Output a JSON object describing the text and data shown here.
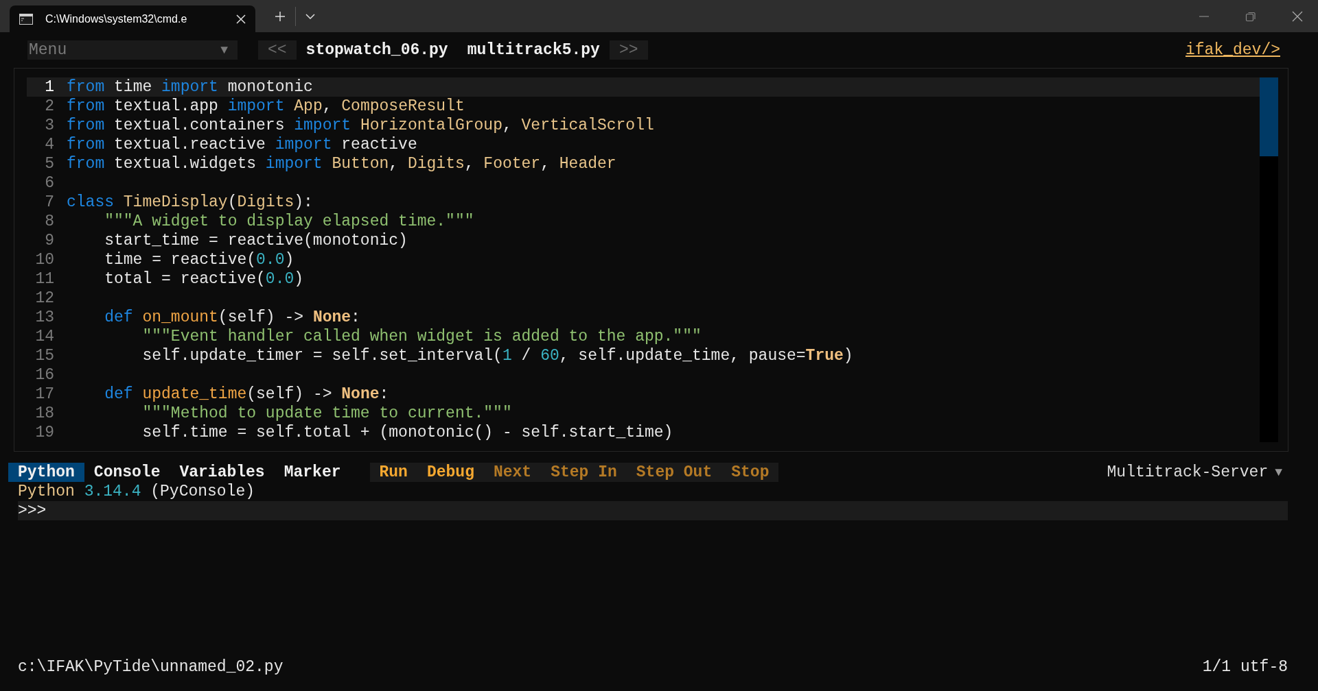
{
  "window": {
    "tab_title": "C:\\Windows\\system32\\cmd.e"
  },
  "toolbar": {
    "menu": {
      "label": "Menu",
      "arrow": "▼"
    },
    "nav_prev": "<<",
    "nav_next": ">>",
    "files": [
      {
        "label": "stopwatch_06.py",
        "selected": false
      },
      {
        "label": "multitrack5.py",
        "selected": false
      }
    ],
    "link": "ifak_dev/>"
  },
  "editor": {
    "lines": [
      {
        "number": "1",
        "current": true,
        "tokens": [
          {
            "kind": "kw",
            "text": "from"
          },
          {
            "kind": "plain",
            "text": " time "
          },
          {
            "kind": "kw",
            "text": "import"
          },
          {
            "kind": "plain",
            "text": " monotonic"
          }
        ]
      },
      {
        "number": "2",
        "current": false,
        "tokens": [
          {
            "kind": "kw",
            "text": "from"
          },
          {
            "kind": "plain",
            "text": " textual.app "
          },
          {
            "kind": "kw",
            "text": "import"
          },
          {
            "kind": "name",
            "text": " App"
          },
          {
            "kind": "plain",
            "text": ", "
          },
          {
            "kind": "name",
            "text": "ComposeResult"
          }
        ]
      },
      {
        "number": "3",
        "current": false,
        "tokens": [
          {
            "kind": "kw",
            "text": "from"
          },
          {
            "kind": "plain",
            "text": " textual.containers "
          },
          {
            "kind": "kw",
            "text": "import"
          },
          {
            "kind": "name",
            "text": " HorizontalGroup"
          },
          {
            "kind": "plain",
            "text": ", "
          },
          {
            "kind": "name",
            "text": "VerticalScroll"
          }
        ]
      },
      {
        "number": "4",
        "current": false,
        "tokens": [
          {
            "kind": "kw",
            "text": "from"
          },
          {
            "kind": "plain",
            "text": " textual.reactive "
          },
          {
            "kind": "kw",
            "text": "import"
          },
          {
            "kind": "plain",
            "text": " reactive"
          }
        ]
      },
      {
        "number": "5",
        "current": false,
        "tokens": [
          {
            "kind": "kw",
            "text": "from"
          },
          {
            "kind": "plain",
            "text": " textual.widgets "
          },
          {
            "kind": "kw",
            "text": "import"
          },
          {
            "kind": "name",
            "text": " Button"
          },
          {
            "kind": "plain",
            "text": ", "
          },
          {
            "kind": "name",
            "text": "Digits"
          },
          {
            "kind": "plain",
            "text": ", "
          },
          {
            "kind": "name",
            "text": "Footer"
          },
          {
            "kind": "plain",
            "text": ", "
          },
          {
            "kind": "name",
            "text": "Header"
          }
        ]
      },
      {
        "number": "6",
        "current": false
      },
      {
        "number": "7",
        "current": false,
        "tokens": [
          {
            "kind": "kw",
            "text": "class"
          },
          {
            "kind": "name",
            "text": " TimeDisplay"
          },
          {
            "kind": "plain",
            "text": "("
          },
          {
            "kind": "name",
            "text": "Digits"
          },
          {
            "kind": "plain",
            "text": "):"
          }
        ]
      },
      {
        "number": "8",
        "current": false,
        "tokens": [
          {
            "kind": "str",
            "text": "    \"\"\"A widget to display elapsed time.\"\"\""
          }
        ]
      },
      {
        "number": "9",
        "current": false,
        "tokens": [
          {
            "kind": "plain",
            "text": "    start_time = reactive(monotonic)"
          }
        ]
      },
      {
        "number": "10",
        "current": false,
        "tokens": [
          {
            "kind": "plain",
            "text": "    time = reactive("
          },
          {
            "kind": "num",
            "text": "0.0"
          },
          {
            "kind": "plain",
            "text": ")"
          }
        ]
      },
      {
        "number": "11",
        "current": false,
        "tokens": [
          {
            "kind": "plain",
            "text": "    total = reactive("
          },
          {
            "kind": "num",
            "text": "0.0"
          },
          {
            "kind": "plain",
            "text": ")"
          }
        ]
      },
      {
        "number": "12",
        "current": false
      },
      {
        "number": "13",
        "current": false,
        "tokens": [
          {
            "kind": "kw",
            "text": "    def"
          },
          {
            "kind": "func",
            "text": " on_mount"
          },
          {
            "kind": "plain",
            "text": "(self) -> "
          },
          {
            "kind": "const",
            "text": "None"
          },
          {
            "kind": "plain",
            "text": ":"
          }
        ]
      },
      {
        "number": "14",
        "current": false,
        "tokens": [
          {
            "kind": "str",
            "text": "        \"\"\"Event handler called when widget is added to the app.\"\"\""
          }
        ]
      },
      {
        "number": "15",
        "current": false,
        "tokens": [
          {
            "kind": "plain",
            "text": "        self.update_timer = self.set_interval("
          },
          {
            "kind": "num",
            "text": "1"
          },
          {
            "kind": "plain",
            "text": " / "
          },
          {
            "kind": "num",
            "text": "60"
          },
          {
            "kind": "plain",
            "text": ", self.update_time, pause="
          },
          {
            "kind": "const",
            "text": "True"
          },
          {
            "kind": "plain",
            "text": ")"
          }
        ]
      },
      {
        "number": "16",
        "current": false
      },
      {
        "number": "17",
        "current": false,
        "tokens": [
          {
            "kind": "kw",
            "text": "    def"
          },
          {
            "kind": "func",
            "text": " update_time"
          },
          {
            "kind": "plain",
            "text": "(self) -> "
          },
          {
            "kind": "const",
            "text": "None"
          },
          {
            "kind": "plain",
            "text": ":"
          }
        ]
      },
      {
        "number": "18",
        "current": false,
        "tokens": [
          {
            "kind": "str",
            "text": "        \"\"\"Method to update time to current.\"\"\""
          }
        ]
      },
      {
        "number": "19",
        "current": false,
        "tokens": [
          {
            "kind": "plain",
            "text": "        self.time = self.total + (monotonic() - self.start_time)"
          }
        ]
      }
    ]
  },
  "panel": {
    "tabs": [
      {
        "label": "Python",
        "selected": true
      },
      {
        "label": "Console",
        "selected": false
      },
      {
        "label": "Variables",
        "selected": false
      },
      {
        "label": "Marker",
        "selected": false
      }
    ],
    "actions": [
      {
        "label": "Run",
        "disabled": false
      },
      {
        "label": "Debug",
        "disabled": false
      },
      {
        "label": "Next",
        "disabled": true
      },
      {
        "label": "Step In",
        "disabled": true
      },
      {
        "label": "Step Out",
        "disabled": true
      },
      {
        "label": "Stop",
        "disabled": true
      }
    ],
    "target": {
      "label": "Multitrack-Server",
      "arrow": "▼"
    },
    "output": [
      {
        "kind": "name",
        "text": "Python"
      },
      {
        "kind": "num",
        "text": " 3.14.4"
      },
      {
        "kind": "plain",
        "text": " (PyConsole)"
      }
    ],
    "prompt": ">>>"
  },
  "status_bar": {
    "path": "c:\\IFAK\\PyTide\\unnamed_02.py",
    "position": "1/1 utf-8"
  }
}
